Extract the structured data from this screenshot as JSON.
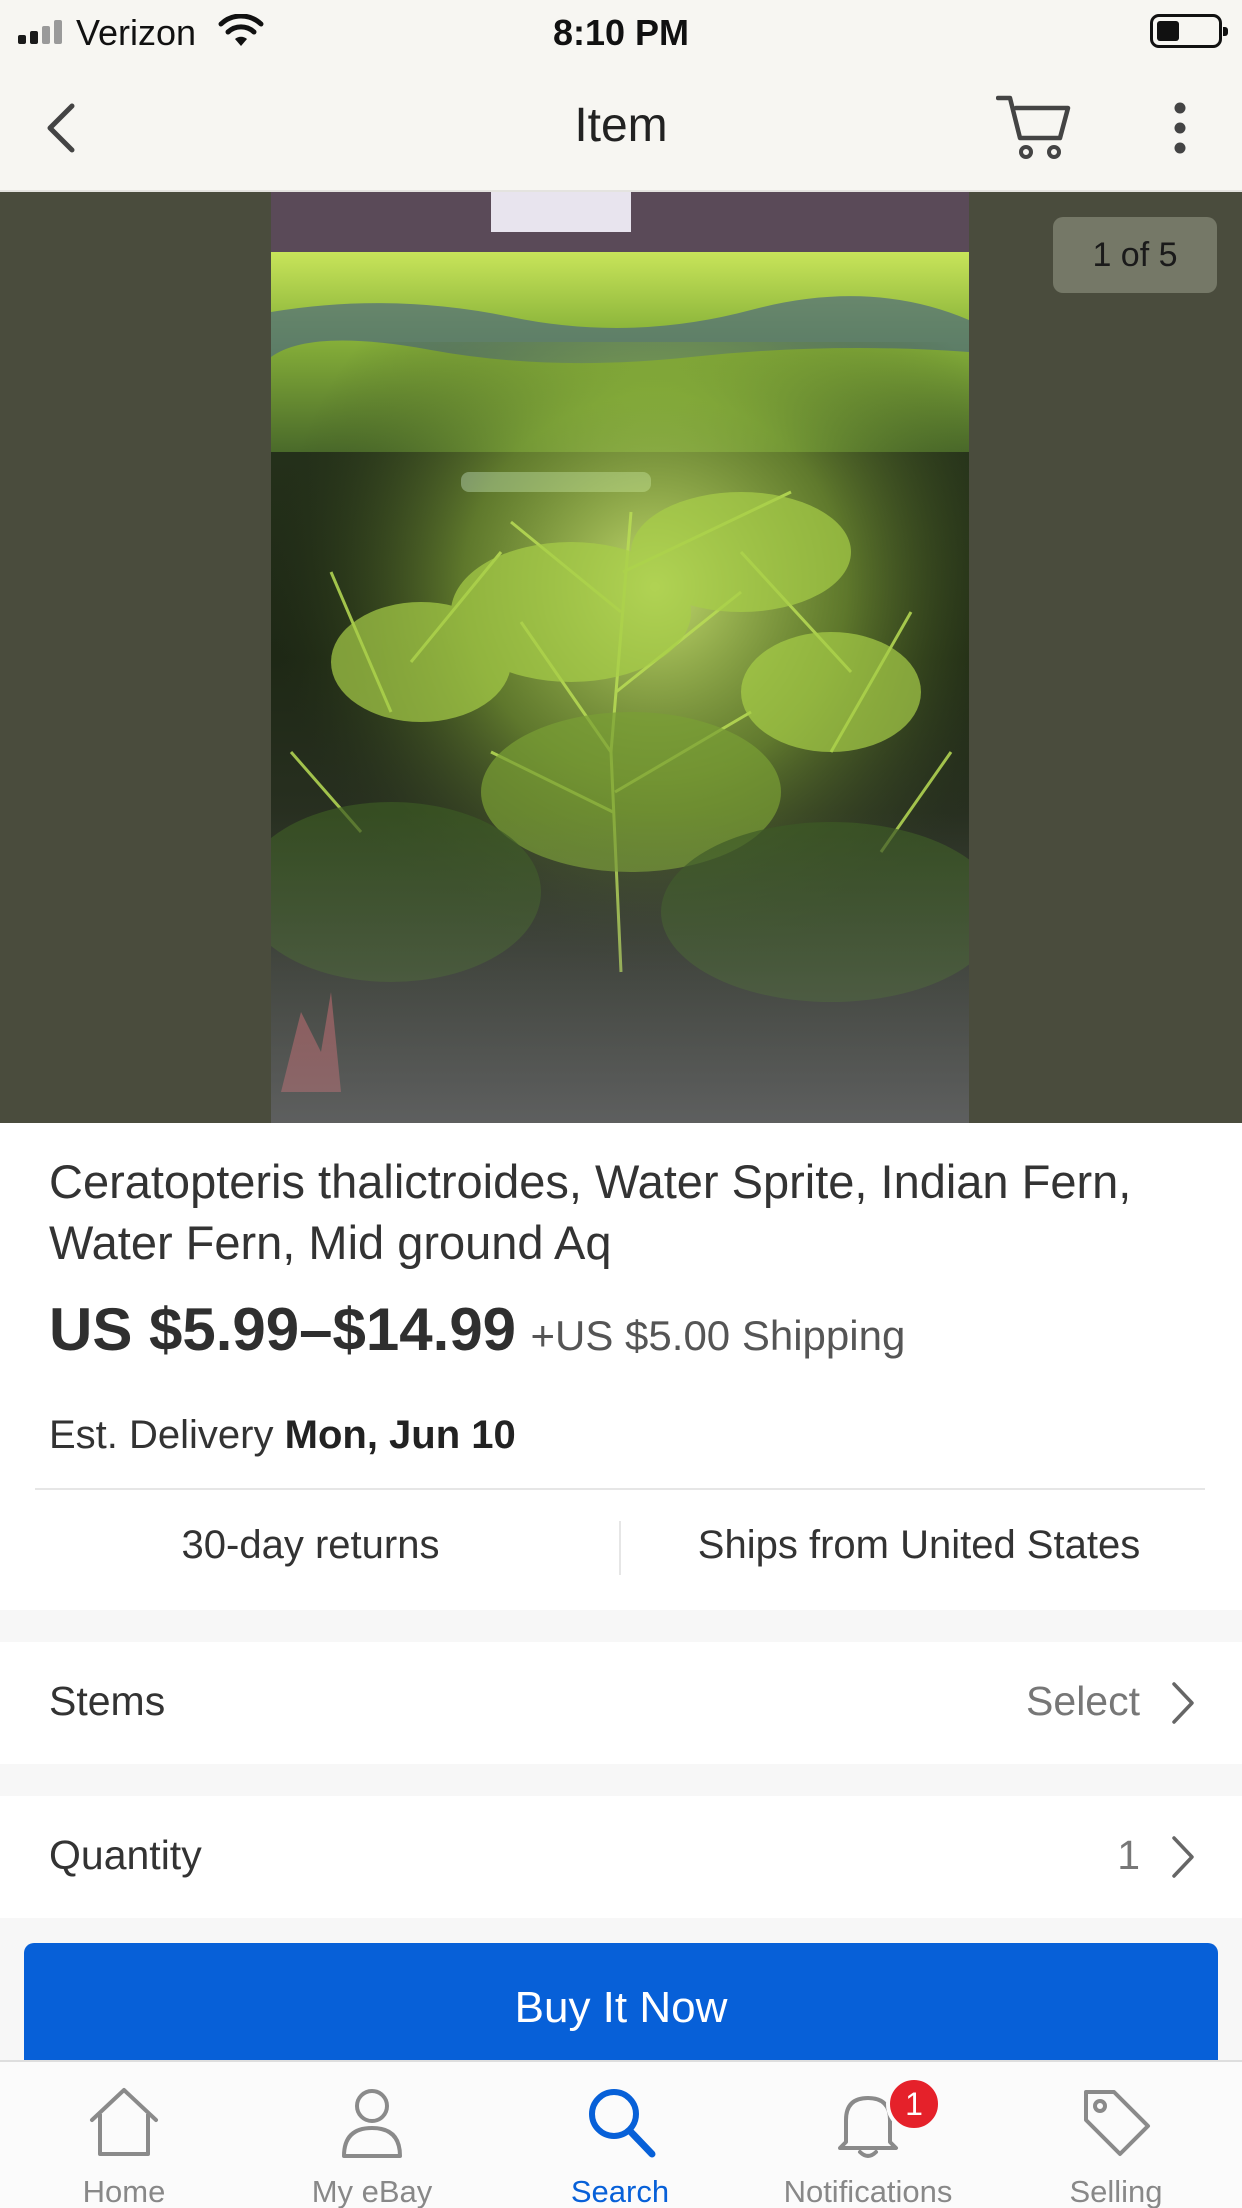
{
  "status_bar": {
    "carrier": "Verizon",
    "time": "8:10 PM"
  },
  "nav": {
    "title": "Item"
  },
  "gallery": {
    "counter": "1 of 5"
  },
  "item": {
    "title": "Ceratopteris thalictroides, Water Sprite, Indian Fern, Water Fern, Mid ground Aq",
    "price": "US $5.99–$14.99",
    "shipping": "+US $5.00 Shipping",
    "delivery_label": "Est. Delivery",
    "delivery_date": "Mon, Jun 10",
    "returns": "30-day returns",
    "ships_from": "Ships from United States"
  },
  "variations": {
    "stems_label": "Stems",
    "stems_value": "Select",
    "quantity_label": "Quantity",
    "quantity_value": "1"
  },
  "actions": {
    "buy_now": "Buy It Now"
  },
  "tabs": [
    {
      "label": "Home",
      "icon": "home-icon"
    },
    {
      "label": "My eBay",
      "icon": "person-icon"
    },
    {
      "label": "Search",
      "icon": "search-icon",
      "active": true
    },
    {
      "label": "Notifications",
      "icon": "bell-icon",
      "badge": "1"
    },
    {
      "label": "Selling",
      "icon": "tag-icon"
    }
  ],
  "colors": {
    "accent": "#0760d8",
    "badge": "#e5212a",
    "gallery_bg": "#4a4c3d"
  }
}
